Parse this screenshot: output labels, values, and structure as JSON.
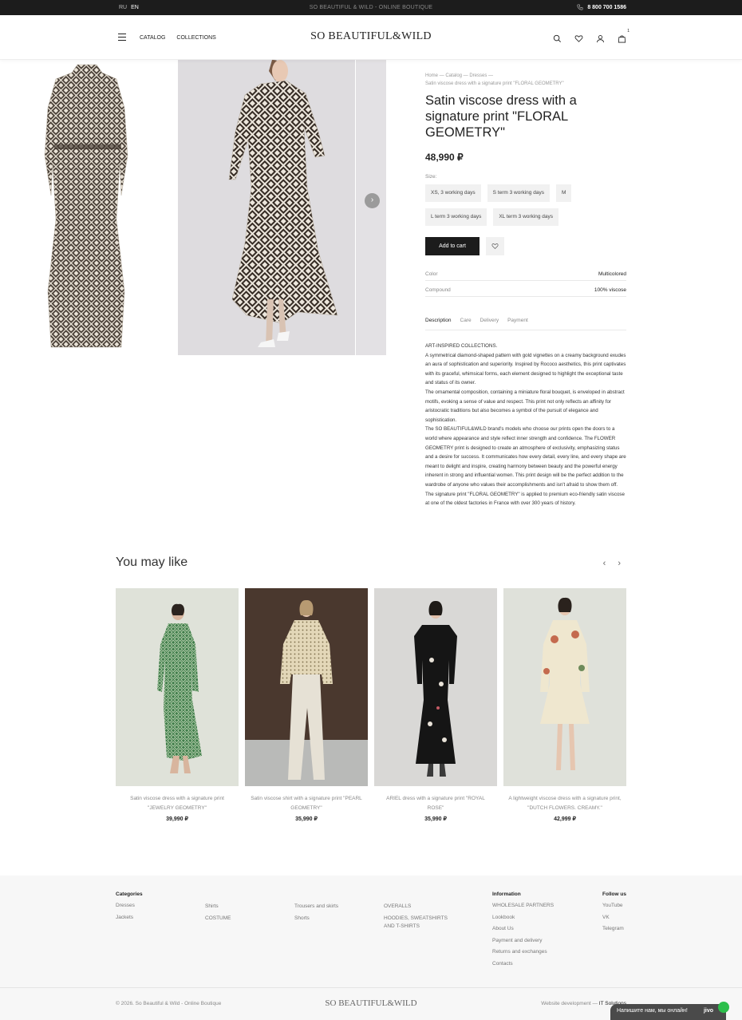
{
  "topbar": {
    "languages": [
      "RU",
      "EN"
    ],
    "active_language": "EN",
    "tagline": "SO BEAUTIFUL & WILD - ONLINE BOUTIQUE",
    "phone": "8 800 700 1586"
  },
  "header": {
    "nav": [
      "CATALOG",
      "COLLECTIONS"
    ],
    "logo": "SO BEAUTIFUL&WILD",
    "cart_count": "1"
  },
  "product": {
    "breadcrumbs": "Home — Catalog — Dresses —",
    "breadcrumb_current": "Satin viscose dress with a signature print \"FLORAL GEOMETRY\"",
    "title": "Satin viscose dress with a signature print \"FLORAL GEOMETRY\"",
    "price": "48,990 ₽",
    "size_label": "Size:",
    "sizes": [
      "XS, 3 working days",
      "S term 3 working days",
      "M",
      "L term 3 working days",
      "XL term 3 working days"
    ],
    "add_to_cart": "Add to cart",
    "attributes": [
      {
        "key": "Color",
        "value": "Multicolored"
      },
      {
        "key": "Compound",
        "value": "100% viscose"
      }
    ],
    "tabs": [
      "Description",
      "Care",
      "Delivery",
      "Payment"
    ],
    "active_tab": "Description",
    "description": [
      "ART-INSPIRED COLLECTIONS.",
      "A symmetrical diamond-shaped pattern with gold vignettes on a creamy background exudes an aura of sophistication and superiority. Inspired by Rococo aesthetics, this print captivates with its graceful, whimsical forms, each element designed to highlight the exceptional taste and status of its owner.",
      "The ornamental composition, containing a miniature floral bouquet, is enveloped in abstract motifs, evoking a sense of value and respect. This print not only reflects an affinity for aristocratic traditions but also becomes a symbol of the pursuit of elegance and sophistication.",
      "The SO BEAUTIFUL&WILD brand's models who choose our prints open the doors to a world where appearance and style reflect inner strength and confidence. The FLOWER GEOMETRY print is designed to create an atmosphere of exclusivity, emphasizing status and a desire for success. It communicates how every detail, every line, and every shape are meant to delight and inspire, creating harmony between beauty and the powerful energy inherent in strong and influential women. This print design will be the perfect addition to the wardrobe of anyone who values their accomplishments and isn't afraid to show them off.",
      "The signature print \"FLORAL GEOMETRY\" is applied to premium eco-friendly satin viscose at one of the oldest factories in France with over 300 years of history."
    ]
  },
  "recommendations": {
    "title": "You may like",
    "items": [
      {
        "name": "Satin viscose dress with a signature print \"JEWELRY GEOMETRY\"",
        "price": "39,990 ₽"
      },
      {
        "name": "Satin viscose shirt with a signature print \"PEARL GEOMETRY\"",
        "price": "35,990 ₽"
      },
      {
        "name": "ARIEL dress with a signature print \"ROYAL ROSE\"",
        "price": "35,990 ₽"
      },
      {
        "name": "A lightweight viscose dress with a signature print, \"DUTCH FLOWERS. CREAMY.\"",
        "price": "42,999 ₽"
      }
    ]
  },
  "footer": {
    "categories_title": "Categories",
    "categories": [
      [
        "Dresses",
        "Jackets"
      ],
      [
        "Shirts",
        "COSTUME"
      ],
      [
        "Trousers and skirts",
        "Shorts"
      ],
      [
        "OVERALLS",
        "HOODIES, SWEATSHIRTS AND T-SHIRTS"
      ]
    ],
    "information_title": "Information",
    "information": [
      "WHOLESALE PARTNERS",
      "Lookbook",
      "About Us",
      "Payment and delivery",
      "Returns and exchanges",
      "Contacts"
    ],
    "follow_title": "Follow us",
    "follow": [
      "YouTube",
      "VK",
      "Telegram"
    ],
    "copyright": "© 2026. So Beautiful & Wild - Online Boutique",
    "logo": "SO BEAUTIFUL&WILD",
    "dev_label": "Website development —",
    "dev_name": "IT Solutions"
  },
  "chat": {
    "label": "Напишите нам, мы онлайн!",
    "brand": "jivo"
  }
}
